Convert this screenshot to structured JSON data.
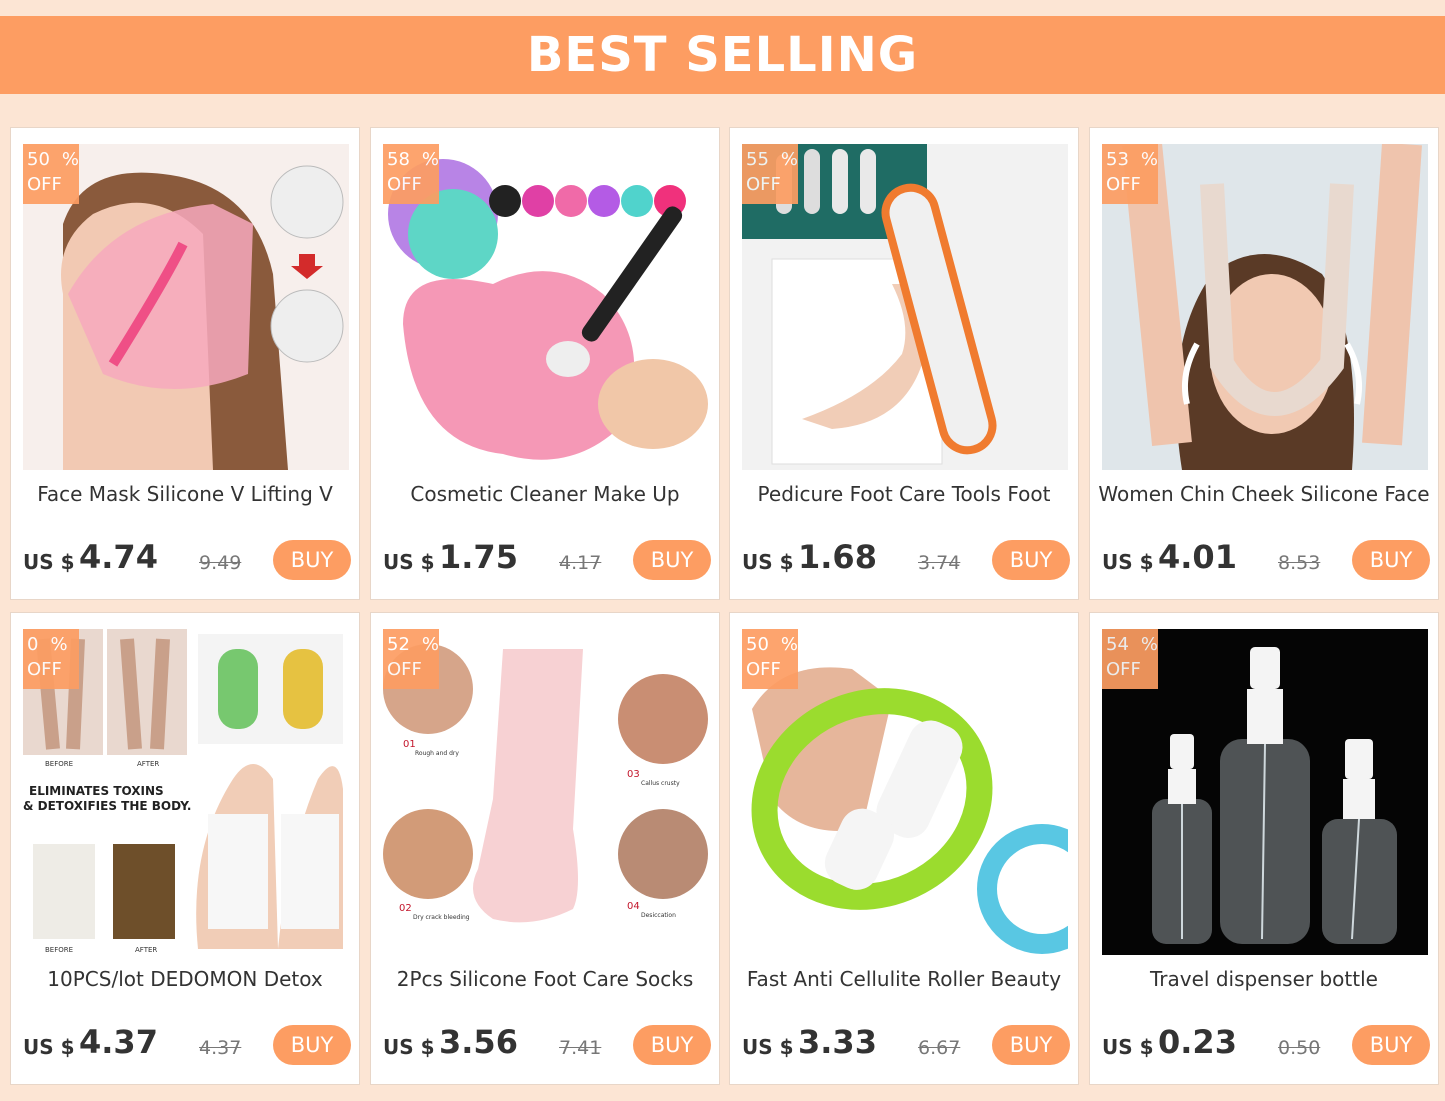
{
  "header": {
    "title": "BEST SELLING"
  },
  "colors": {
    "accent": "#fd9d62",
    "background": "#fce5d4"
  },
  "products": [
    {
      "title": "Face Mask Silicone V Lifting V",
      "currency": "US $",
      "price": "4.74",
      "old_price": "9.49",
      "discount": "50",
      "pct_sign": "%",
      "off": "OFF",
      "buy": "BUY",
      "image": "face-mask-photo"
    },
    {
      "title": "Cosmetic Cleaner Make Up",
      "currency": "US $",
      "price": "1.75",
      "old_price": "4.17",
      "discount": "58",
      "pct_sign": "%",
      "off": "OFF",
      "buy": "BUY",
      "image": "brush-cleaner-photo"
    },
    {
      "title": "Pedicure Foot Care Tools Foot",
      "currency": "US $",
      "price": "1.68",
      "old_price": "3.74",
      "discount": "55",
      "pct_sign": "%",
      "off": "OFF",
      "buy": "BUY",
      "image": "foot-file-photo"
    },
    {
      "title": "Women Chin Cheek Silicone Face",
      "currency": "US $",
      "price": "4.01",
      "old_price": "8.53",
      "discount": "53",
      "pct_sign": "%",
      "off": "OFF",
      "buy": "BUY",
      "image": "chin-strap-photo"
    },
    {
      "title": "10PCS/lot DEDOMON Detox",
      "currency": "US $",
      "price": "4.37",
      "old_price": "4.37",
      "discount": "0",
      "pct_sign": "%",
      "off": "OFF",
      "buy": "BUY",
      "image": "detox-patch-photo",
      "image_text": {
        "before": "BEFORE",
        "after": "AFTER",
        "line1": "ELIMINATES TOXINS",
        "line2": "& DETOXIFIES THE BODY."
      }
    },
    {
      "title": "2Pcs Silicone Foot Care Socks",
      "currency": "US $",
      "price": "3.56",
      "old_price": "7.41",
      "discount": "52",
      "pct_sign": "%",
      "off": "OFF",
      "buy": "BUY",
      "image": "foot-socks-photo",
      "image_text": {
        "n1": "01",
        "l1": "Rough and dry",
        "n2": "02",
        "l2": "Dry crack bleeding",
        "n3": "03",
        "l3": "Callus crusty",
        "n4": "04",
        "l4": "Desiccation"
      }
    },
    {
      "title": "Fast Anti Cellulite Roller Beauty",
      "currency": "US $",
      "price": "3.33",
      "old_price": "6.67",
      "discount": "50",
      "pct_sign": "%",
      "off": "OFF",
      "buy": "BUY",
      "image": "roller-photo"
    },
    {
      "title": "Travel dispenser bottle",
      "currency": "US $",
      "price": "0.23",
      "old_price": "0.50",
      "discount": "54",
      "pct_sign": "%",
      "off": "OFF",
      "buy": "BUY",
      "image": "spray-bottle-photo"
    }
  ]
}
